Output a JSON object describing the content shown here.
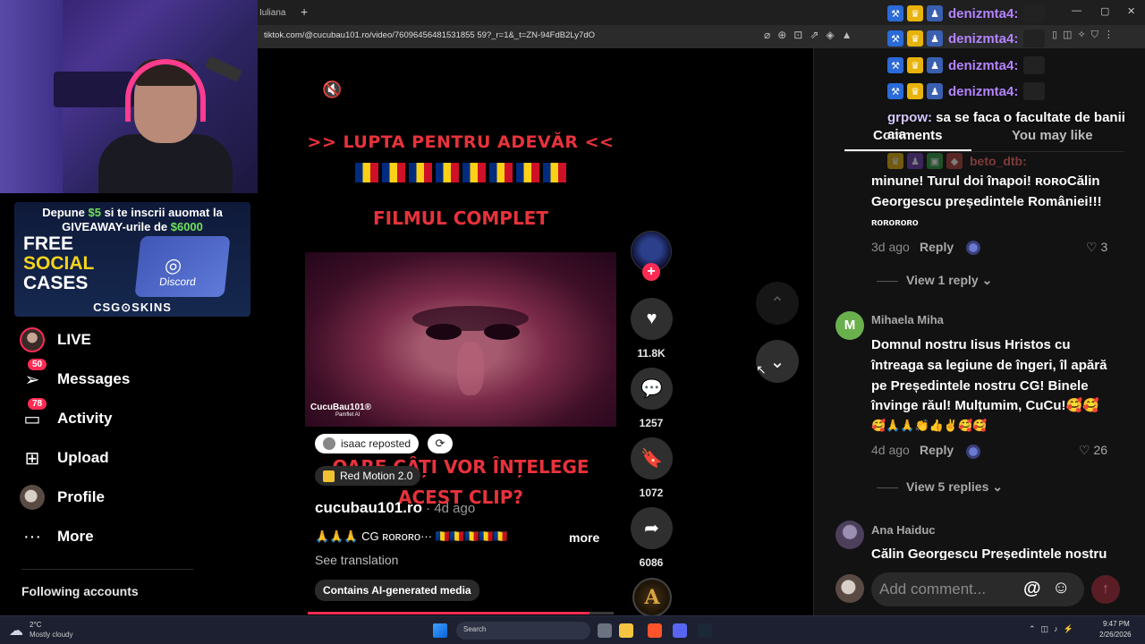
{
  "browser": {
    "tab_label": "Iuliana",
    "new_tab_symbol": "+",
    "url": "tiktok.com/@cucubau101.ro/video/76096456481531855 59?_r=1&_t=ZN-94FdB2Ly7dO",
    "window_controls": [
      "—",
      "▢",
      "✕"
    ]
  },
  "stream_overlay": {
    "giveaway_line1_prefix": "Depune ",
    "giveaway_line1_amount": "$5",
    "giveaway_line1_suffix": " si te inscrii auomat la",
    "giveaway_line2_prefix": "GIVEAWAY-urile de ",
    "giveaway_line2_amount": "$6000",
    "free": "FREE",
    "social": "SOCIAL",
    "cases": "CASES",
    "box_brand": "Discord",
    "brand": "CSG⊙SKINS",
    "chat": [
      {
        "user": "denizmta4:"
      },
      {
        "user": "denizmta4:"
      },
      {
        "user": "denizmta4:"
      },
      {
        "user": "denizmta4:"
      }
    ],
    "grpow_user": "grpow:",
    "grpow_message": " sa se faca o facultate de banii aia",
    "beto_user": "beto_dtb:"
  },
  "sidebar": {
    "items": [
      {
        "label": "LIVE",
        "badge": ""
      },
      {
        "label": "Messages",
        "badge": "50"
      },
      {
        "label": "Activity",
        "badge": "78"
      },
      {
        "label": "Upload",
        "badge": ""
      },
      {
        "label": "Profile",
        "badge": ""
      },
      {
        "label": "More",
        "badge": ""
      }
    ],
    "following_accounts": "Following accounts"
  },
  "video": {
    "headline": ">> LUPTA PENTRU ADEVĂR <<",
    "subhead": "FILMUL COMPLET",
    "watermark": "CucuBau101®",
    "watermark_sub": "Pamflet AI",
    "bottom_question_line1": "OARE CÂȚI VOR ÎNȚELEGE",
    "bottom_question_line2": "ACEST CLIP?",
    "repost_label": "isaac reposted",
    "effect_label": "Red Motion 2.0",
    "author": "cucubau101.ro",
    "date": " · 4d ago",
    "caption": "🙏🙏🙏 CG ʀᴏʀᴏʀᴏ··· 🇷🇴🇷🇴🇷🇴🇷🇴🇷🇴",
    "more": "more",
    "see_translation": "See translation",
    "ai_label": "Contains AI-generated media",
    "progress": 0.92
  },
  "actions": {
    "likes": "11.8K",
    "comments": "1257",
    "saves": "1072",
    "shares": "6086",
    "music_letter": "A"
  },
  "panel": {
    "tab_comments": "Comments",
    "tab_you_may_like": "You may like",
    "comment1": {
      "text_line1": "minune! Turul doi înapoi! ʀᴏʀᴏCălin",
      "text_line2": "Georgescu președintele României!!!",
      "text_line3": "ʀᴏʀᴏʀᴏʀᴏ",
      "date": "3d ago",
      "reply": "Reply",
      "likes": "3",
      "view_replies": "View 1 reply"
    },
    "comment2": {
      "avatar_letter": "M",
      "name": "Mihaela Miha",
      "text_line1": "Domnul nostru Iisus Hristos cu",
      "text_line2": "întreaga sa legiune de îngeri, îl apără",
      "text_line3": "pe Președintele nostru CG! Binele",
      "text_line4": "învinge răul! Mulțumim, CuCu!🥰🥰",
      "text_line5": "🥰🙏🙏👏👍✌️🥰🥰",
      "date": "4d ago",
      "reply": "Reply",
      "likes": "26",
      "view_replies": "View 5 replies"
    },
    "comment3": {
      "name": "Ana Haiduc",
      "text_line1": "Călin Georgescu Președintele nostru"
    },
    "add_comment_placeholder": "Add comment...",
    "at_symbol": "@",
    "emoji_symbol": "☺",
    "send_symbol": "↑"
  },
  "taskbar": {
    "temp": "2°C",
    "weather": "Mostly cloudy",
    "search": "Search",
    "time": "9:47 PM",
    "date": "2/26/2026"
  }
}
